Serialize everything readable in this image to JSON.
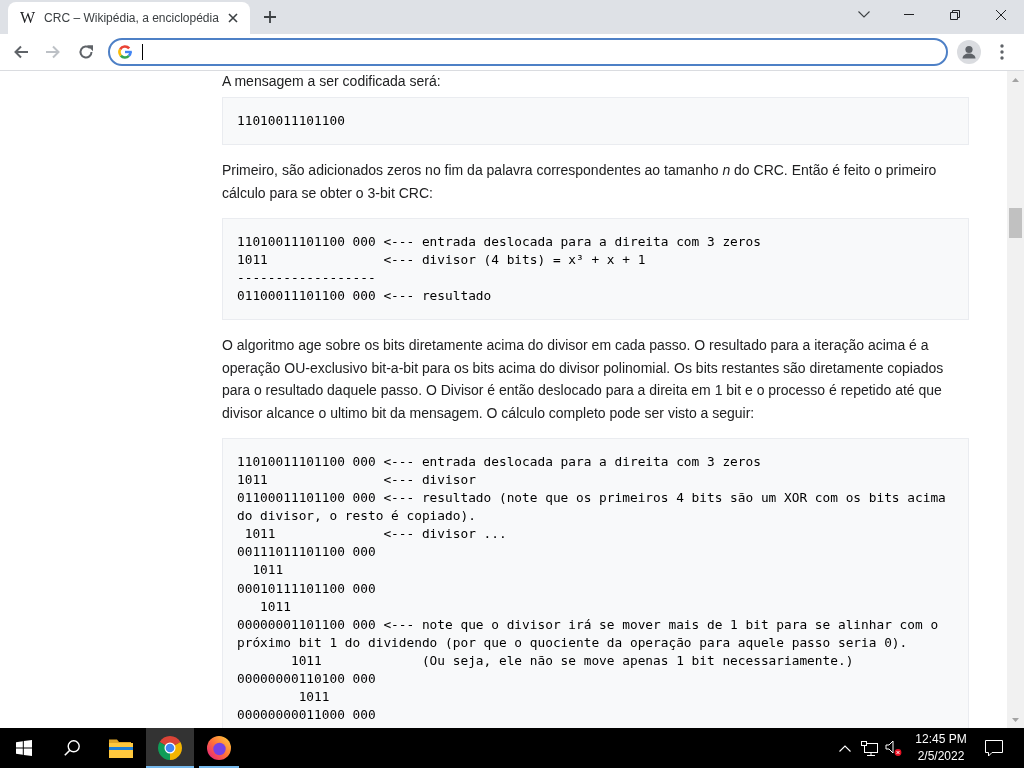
{
  "browser": {
    "tabs": [
      {
        "favicon": "W",
        "title": "CRC – Wikipédia, a enciclopédia",
        "selected": true
      }
    ],
    "back": {
      "disabled": false
    },
    "forward": {
      "disabled": true
    },
    "address_bar": {
      "focused": true
    }
  },
  "article": {
    "blocks": [
      {
        "kind": "paragraph",
        "text": "A mensagem a ser codificada será:"
      },
      {
        "kind": "code",
        "lines": [
          "11010011101100"
        ]
      },
      {
        "kind": "paragraph",
        "text": "Primeiro, são adicionados zeros no fim da palavra correspondentes ao tamanho *n* do CRC. Então é feito o primeiro cálculo para se obter o 3-bit CRC:"
      },
      {
        "kind": "code",
        "lines": [
          "11010011101100 000 <--- entrada deslocada para a direita com 3 zeros",
          "1011               <--- divisor (4 bits) = x³ + x + 1",
          "------------------",
          "01100011101100 000 <--- resultado"
        ]
      },
      {
        "kind": "paragraph",
        "text": "O algoritmo age sobre os bits diretamente acima do divisor em cada passo. O resultado para a iteração acima é a operação OU-exclusivo bit-a-bit para os bits acima do divisor polinomial. Os bits restantes são diretamente copiados para o resultado daquele passo. O Divisor é então deslocado para a direita em 1 bit e o processo é repetido até que divisor alcance o ultimo bit da mensagem. O cálculo completo pode ser visto a seguir:"
      },
      {
        "kind": "code",
        "lines": [
          "11010011101100 000 <--- entrada deslocada para a direita com 3 zeros",
          "1011               <--- divisor",
          "01100011101100 000 <--- resultado (note que os primeiros 4 bits são um XOR com os bits acima",
          "do divisor, o resto é copiado).",
          " 1011              <--- divisor ...",
          "00111011101100 000",
          "  1011",
          "00010111101100 000",
          "   1011",
          "00000001101100 000 <--- note que o divisor irá se mover mais de 1 bit para se alinhar com o",
          "próximo bit 1 do dividendo (por que o quociente da operação para aquele passo seria 0).",
          "       1011             (Ou seja, ele não se move apenas 1 bit necessariamente.)",
          "00000000110100 000",
          "        1011",
          "00000000011000 000"
        ]
      }
    ]
  },
  "taskbar": {
    "apps": [
      {
        "kind": "explorer",
        "selected": false,
        "running": false
      },
      {
        "kind": "chrome",
        "selected": true,
        "running": true
      },
      {
        "kind": "firefox",
        "selected": false,
        "running": true
      }
    ],
    "clock": {
      "time": "12:45 PM",
      "date": "2/5/2022"
    }
  }
}
